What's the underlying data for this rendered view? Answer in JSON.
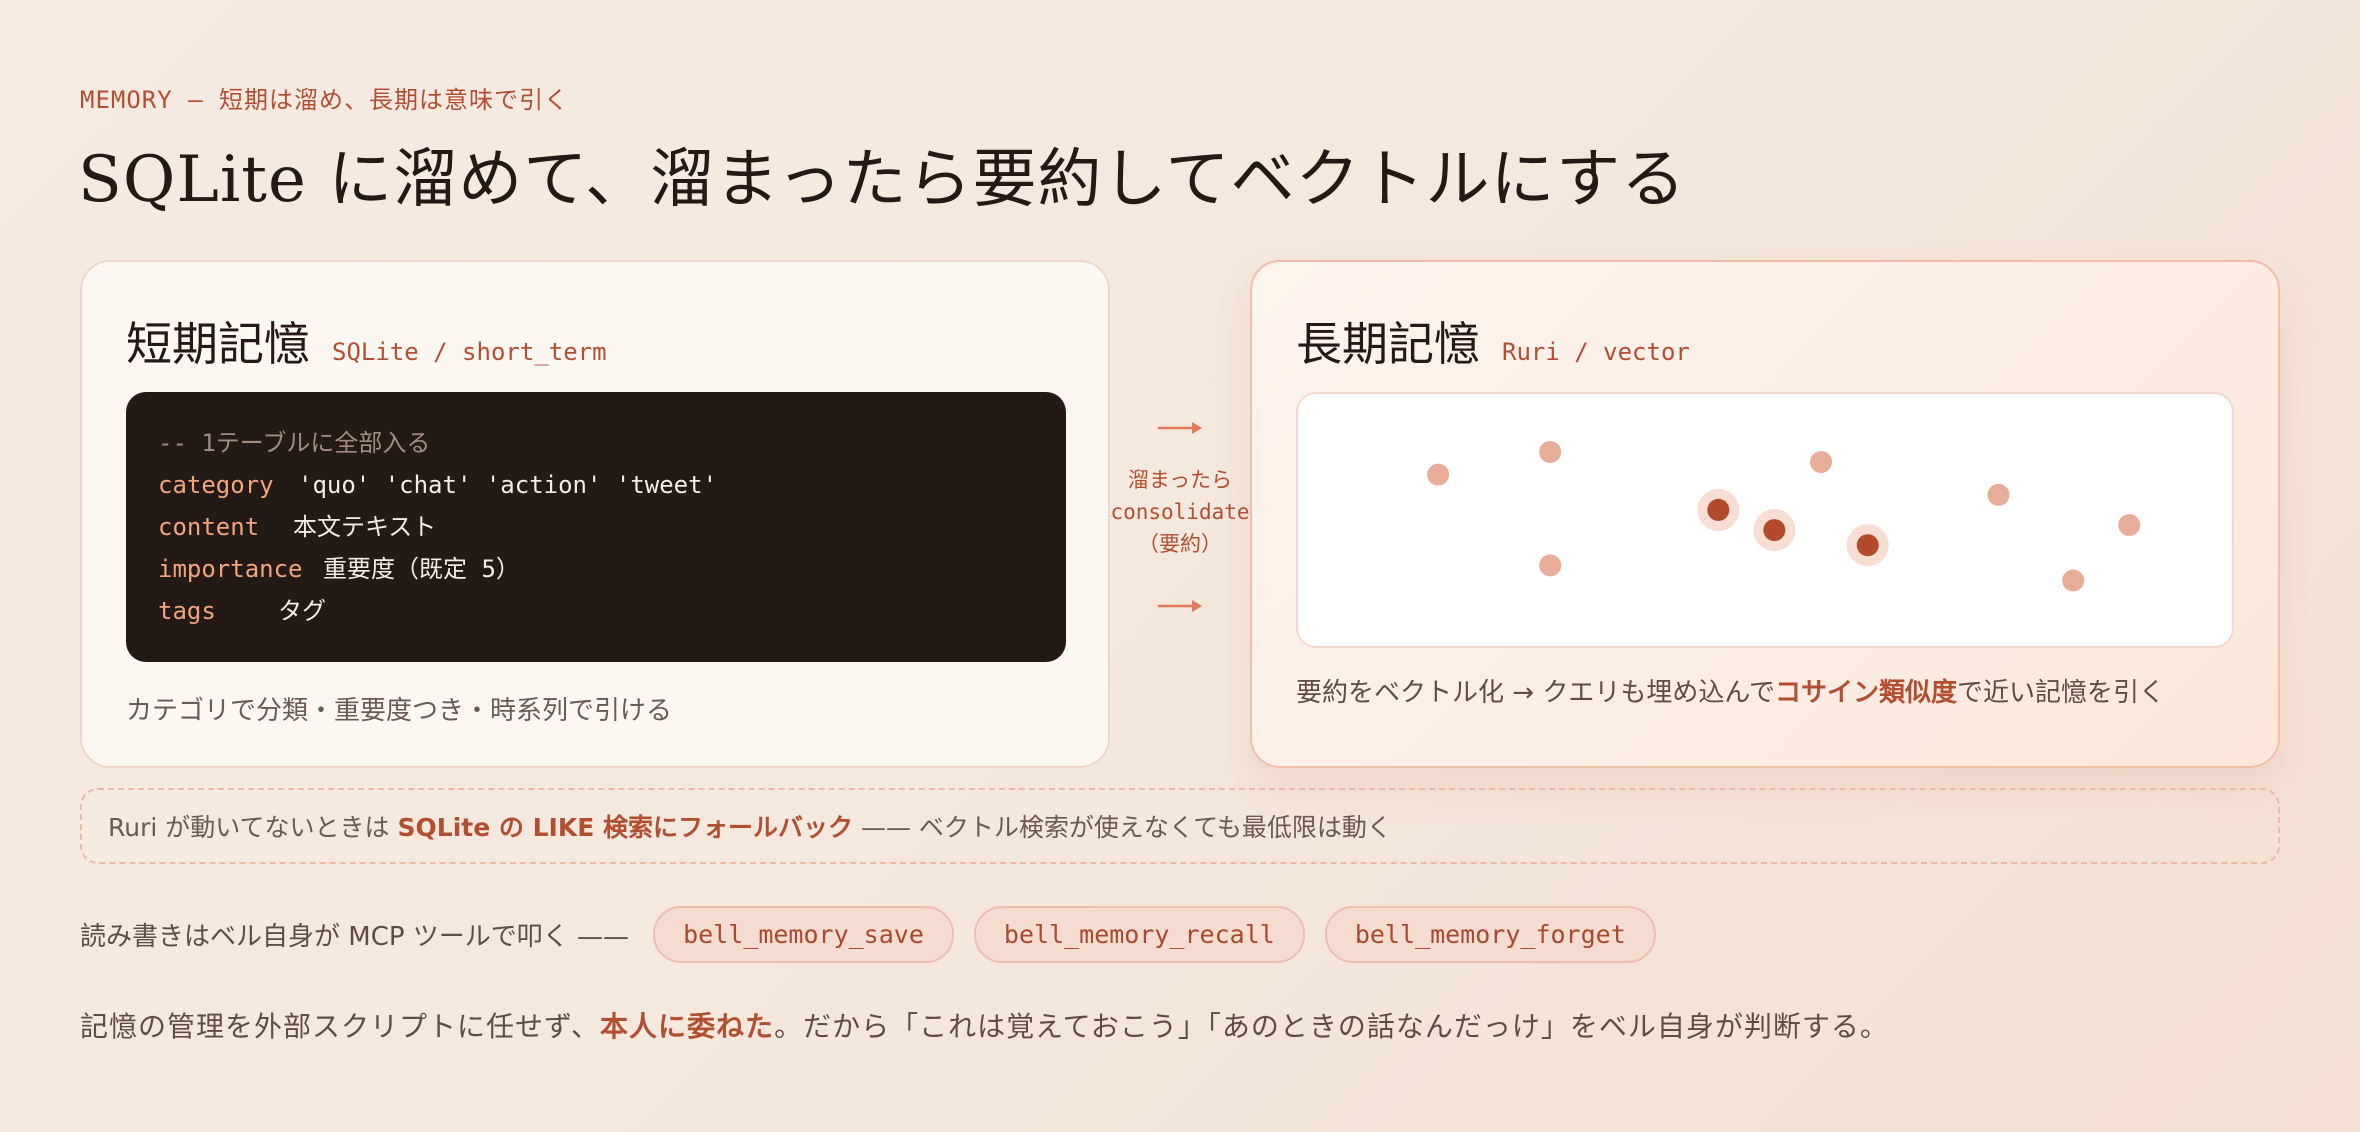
{
  "eyebrow": "MEMORY — 短期は溜め、長期は意味で引く",
  "title": "SQLite に溜めて、溜まったら要約してベクトルにする",
  "short_term": {
    "title": "短期記憶",
    "subtitle": "SQLite / short_term",
    "code": {
      "comment": "-- 1テーブルに全部入る",
      "rows": [
        {
          "key": "category",
          "value": "'quo' 'chat' 'action' 'tweet'"
        },
        {
          "key": "content",
          "value": "本文テキスト"
        },
        {
          "key": "importance",
          "value": "重要度（既定 5）"
        },
        {
          "key": "tags",
          "value": "タグ"
        }
      ]
    },
    "caption": "カテゴリで分類・重要度つき・時系列で引ける"
  },
  "transition": {
    "label_line1": "溜まったら",
    "label_line2": "consolidate",
    "label_line3": "（要約）",
    "color": "#e07a5a"
  },
  "long_term": {
    "title": "長期記憶",
    "subtitle": "Ruri / vector",
    "caption_pre": "要約をベクトル化 → クエリも埋め込んで",
    "caption_highlight": "コサイン類似度",
    "caption_post": "で近い記憶を引く",
    "points": [
      {
        "x": 0.15,
        "y": 0.68,
        "highlighted": false
      },
      {
        "x": 0.27,
        "y": 0.77,
        "highlighted": false
      },
      {
        "x": 0.27,
        "y": 0.32,
        "highlighted": false
      },
      {
        "x": 0.45,
        "y": 0.54,
        "highlighted": true
      },
      {
        "x": 0.51,
        "y": 0.46,
        "highlighted": true
      },
      {
        "x": 0.56,
        "y": 0.73,
        "highlighted": false
      },
      {
        "x": 0.61,
        "y": 0.4,
        "highlighted": true
      },
      {
        "x": 0.75,
        "y": 0.6,
        "highlighted": false
      },
      {
        "x": 0.83,
        "y": 0.26,
        "highlighted": false
      },
      {
        "x": 0.89,
        "y": 0.48,
        "highlighted": false
      }
    ],
    "point_color": "#e8ad98",
    "highlight_color": "#b24a2c",
    "highlight_halo": "#f7ddd2"
  },
  "fallback": {
    "pre": "Ruri が動いてないときは",
    "highlight": "SQLite の LIKE 検索にフォールバック",
    "post": "—— ベクトル検索が使えなくても最低限は動く"
  },
  "tools": {
    "label": "読み書きはベル自身が MCP ツールで叩く ——",
    "items": [
      "bell_memory_save",
      "bell_memory_recall",
      "bell_memory_forget"
    ]
  },
  "closing": {
    "pre": "記憶の管理を外部スクリプトに任せず、",
    "highlight": "本人に委ねた",
    "post": "。だから「これは覚えておこう」「あのときの話なんだっけ」をベル自身が判断する。"
  },
  "colors": {
    "accent": "#b24f33",
    "code_bg": "#241a15",
    "code_key": "#f0a57e"
  }
}
